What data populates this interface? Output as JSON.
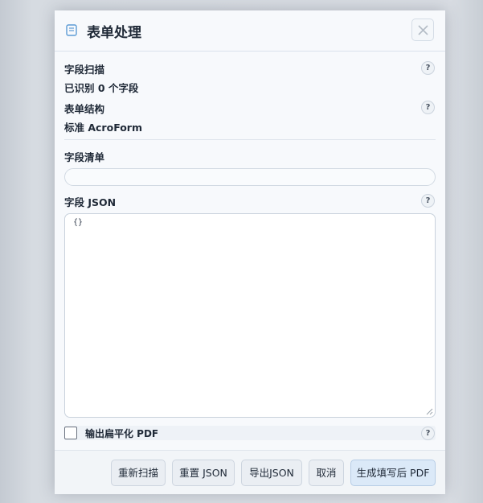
{
  "dialog": {
    "title": "表单处理",
    "title_icon": "form-icon",
    "close_icon": "close-icon"
  },
  "scan": {
    "label": "字段扫描",
    "value": "已识别 0 个字段"
  },
  "structure": {
    "label": "表单结构",
    "value": "标准 AcroForm"
  },
  "field_list": {
    "label": "字段清单",
    "value": ""
  },
  "field_json": {
    "label": "字段 JSON",
    "value": "{}"
  },
  "flatten": {
    "label": "输出扁平化 PDF",
    "checked": false
  },
  "help_glyph": "?",
  "footer": {
    "rescan": "重新扫描",
    "reset_json": "重置 JSON",
    "export_json": "导出JSON",
    "cancel": "取消",
    "generate": "生成填写后 PDF"
  },
  "colors": {
    "accent": "#5b9bd5",
    "primary_button": "#dbe9f8",
    "backdrop": "#c9cfd6"
  }
}
